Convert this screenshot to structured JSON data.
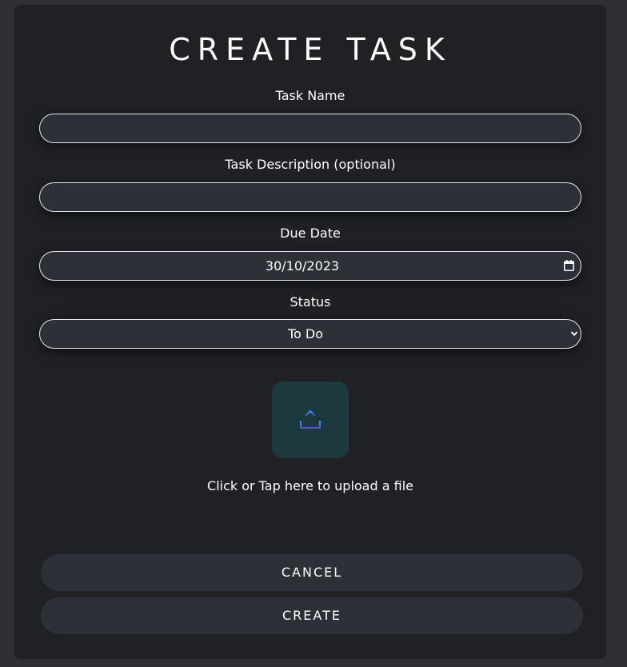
{
  "form": {
    "title": "CREATE TASK",
    "task_name": {
      "label": "Task Name",
      "value": ""
    },
    "task_description": {
      "label": "Task Description (optional)",
      "value": ""
    },
    "due_date": {
      "label": "Due Date",
      "value": "30/10/2023",
      "icon": "calendar-icon"
    },
    "status": {
      "label": "Status",
      "value": "To Do",
      "icon": "chevron-down-icon"
    },
    "upload": {
      "text": "Click or Tap here to upload a file",
      "icon": "upload-icon",
      "tile_color": "#1c3a3e",
      "icon_colors": [
        "#1fa6ff",
        "#5b4ddb"
      ]
    },
    "buttons": {
      "cancel": "CANCEL",
      "create": "CREATE"
    }
  },
  "colors": {
    "background": "#2e3036",
    "modal": "#1f2124",
    "field": "#2e3038",
    "text": "#ffffff"
  }
}
